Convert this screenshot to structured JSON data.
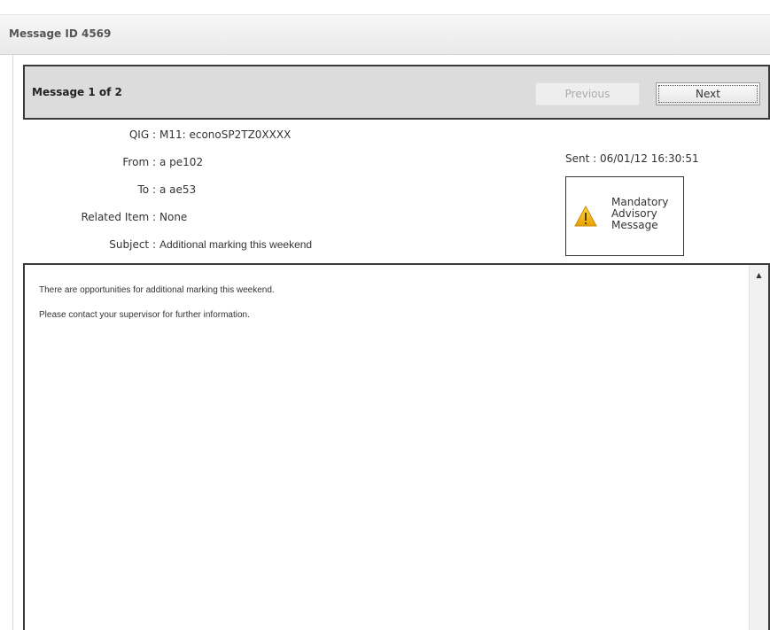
{
  "window": {
    "title": "Message ID 4569"
  },
  "nav": {
    "counter": "Message 1 of 2",
    "previous_label": "Previous",
    "next_label": "Next"
  },
  "details": {
    "qig": {
      "label": "QIG :",
      "value": "M11: econoSP2TZ0XXXX"
    },
    "from": {
      "label": "From :",
      "value": "a pe102"
    },
    "to": {
      "label": "To :",
      "value": "a ae53"
    },
    "related_item": {
      "label": "Related Item :",
      "value": "None"
    },
    "subject": {
      "label": "Subject :",
      "value": "Additional marking this weekend"
    },
    "sent": "Sent : 06/01/12 16:30:51"
  },
  "priority": {
    "icon": "warning-triangle-icon",
    "lines": [
      "Mandatory",
      "Advisory",
      "Message"
    ]
  },
  "body": {
    "lines": [
      "There are opportunities for additional marking this weekend.",
      "Please contact your supervisor for further information."
    ]
  },
  "colors": {
    "warning": "#f0b400",
    "bar": "#dcdcdc",
    "border": "#3a3a3a"
  }
}
